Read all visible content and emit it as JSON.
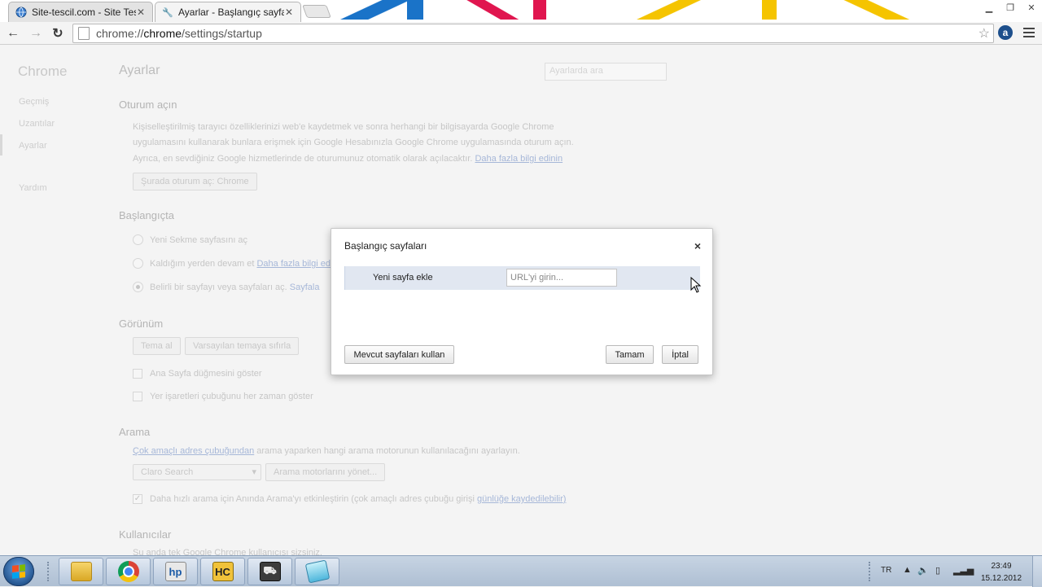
{
  "browser": {
    "tabs": [
      {
        "title": "Site-tescil.com - Site Tesci",
        "icon": "globe-icon"
      },
      {
        "title": "Ayarlar - Başlangıç sayfala",
        "icon": "wrench-icon"
      }
    ],
    "url_prefix": "chrome://",
    "url_host": "chrome",
    "url_path": "/settings/startup",
    "extension_label": "a"
  },
  "sidebar": {
    "title": "Chrome",
    "items": [
      "Geçmiş",
      "Uzantılar",
      "Ayarlar",
      "Yardım"
    ]
  },
  "settings": {
    "title": "Ayarlar",
    "search_placeholder": "Ayarlarda ara",
    "signin": {
      "heading": "Oturum açın",
      "line1": "Kişiselleştirilmiş tarayıcı özelliklerinizi web'e kaydetmek ve sonra herhangi bir bilgisayarda Google Chrome",
      "line2": "uygulamasını kullanarak bunlara erişmek için Google Hesabınızla Google Chrome uygulamasında oturum açın.",
      "line3": "Ayrıca, en sevdiğiniz Google hizmetlerinde de oturumunuz otomatik olarak açılacaktır.",
      "more_link": "Daha fazla bilgi edinin",
      "button": "Şurada oturum aç: Chrome"
    },
    "startup": {
      "heading": "Başlangıçta",
      "opt1": "Yeni Sekme sayfasını aç",
      "opt2": "Kaldığım yerden devam et",
      "opt2_link": "Daha fazla bilgi edi",
      "opt3": "Belirli bir sayfayı veya sayfaları aç.",
      "opt3_link": "Sayfala"
    },
    "appearance": {
      "heading": "Görünüm",
      "theme_button": "Tema al",
      "reset_button": "Varsayılan temaya sıfırla",
      "home_check": "Ana Sayfa düğmesini göster",
      "bookmarks_check": "Yer işaretleri çubuğunu her zaman göster"
    },
    "search": {
      "heading": "Arama",
      "desc_link": "Çok amaçlı adres çubuğundan",
      "desc": "arama yaparken hangi arama motorunun kullanılacağını ayarlayın.",
      "engine": "Claro Search",
      "manage_button": "Arama motorlarını yönet...",
      "instant_check": "Daha hızlı arama için Anında Arama'yı etkinleştirin (çok amaçlı adres çubuğu girişi",
      "instant_link": "günlüğe kaydedilebilir)"
    },
    "users": {
      "heading": "Kullanıcılar",
      "desc": "Şu anda tek Google Chrome kullanıcısı sizsiniz."
    }
  },
  "dialog": {
    "title": "Başlangıç sayfaları",
    "close": "×",
    "row_label": "Yeni sayfa ekle",
    "url_placeholder": "URL'yi girin...",
    "use_current": "Mevcut sayfaları kullan",
    "ok": "Tamam",
    "cancel": "İptal"
  },
  "taskbar": {
    "apps": [
      "folder-icon",
      "chrome-icon",
      "hp-icon",
      "hypercam-icon",
      "game-icon",
      "paint-icon"
    ],
    "hp_label": "hp",
    "hyper_label": "HC",
    "lang": "TR",
    "time": "23:49",
    "date": "15.12.2012"
  }
}
